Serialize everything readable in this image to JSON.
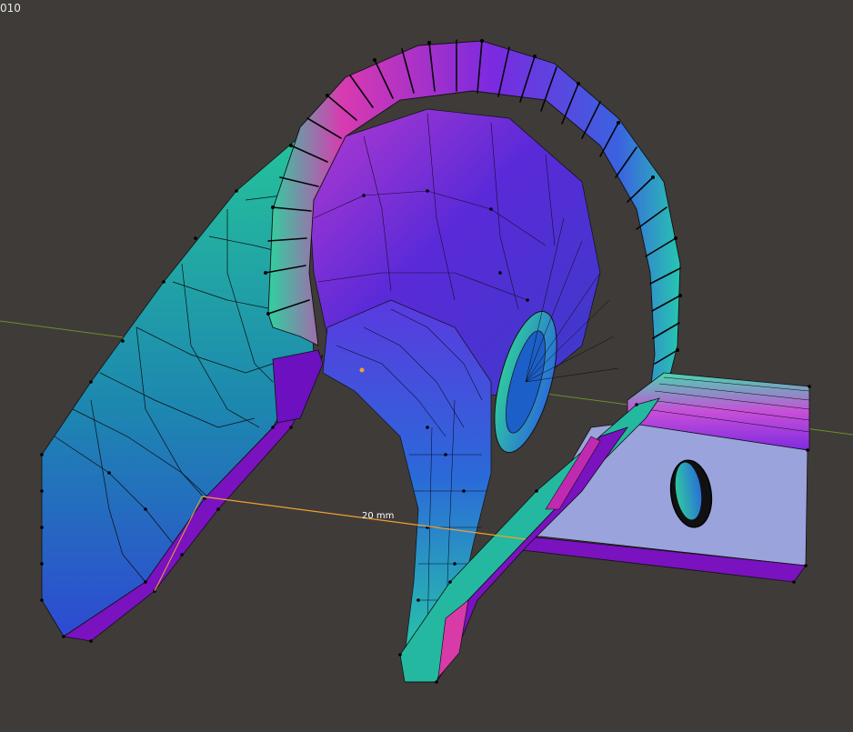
{
  "viewport": {
    "object_label": "010",
    "measure_label": "20 mm",
    "background": "#3f3b39",
    "axis_x_color": "#6b8e2e",
    "measure_color": "#f0a030"
  },
  "materials": {
    "teal": "#1fb39a",
    "blue": "#2f4fd0",
    "violet": "#6a22c0",
    "magenta": "#d030a8",
    "lavender": "#9aa3dc"
  }
}
